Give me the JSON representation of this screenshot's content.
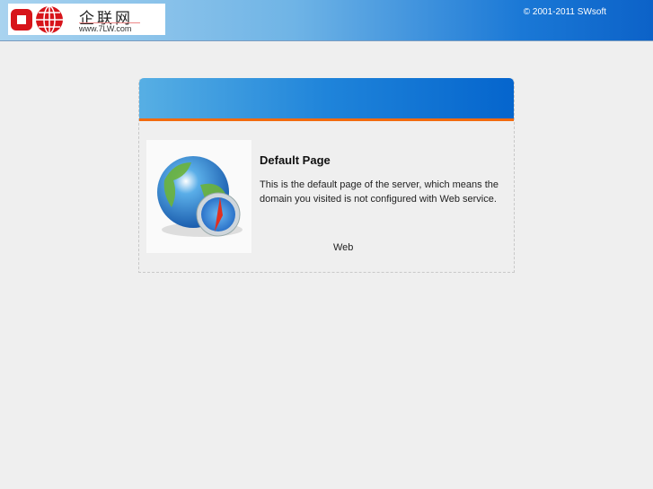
{
  "header": {
    "logo_cn": "企联网",
    "logo_url": "www.7LW.com",
    "copyright": "© 2001-2011 SWsoft"
  },
  "card": {
    "title": "Default Page",
    "description": "This is the default page of the server, which means the domain you visited is not configured with Web service.",
    "link": "Web"
  },
  "colors": {
    "accent": "#f26a0e",
    "header_blue": "#1a78d6"
  }
}
